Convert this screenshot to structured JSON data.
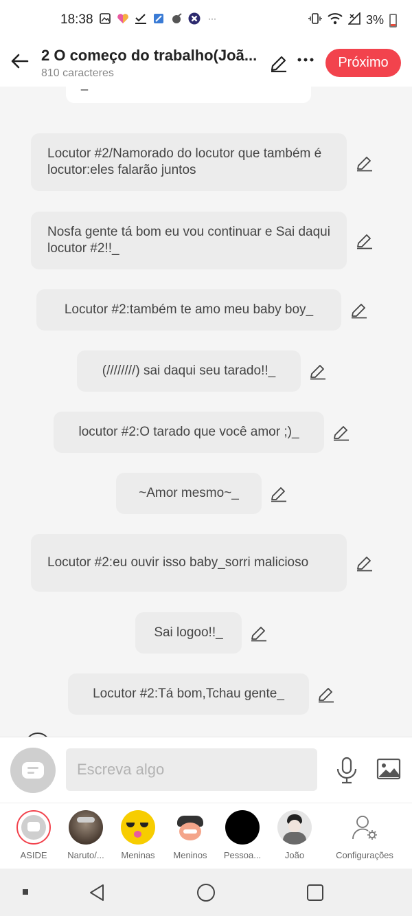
{
  "status_bar": {
    "time": "18:38",
    "battery": "3%",
    "icons_left": [
      "gallery-icon",
      "heart-app-icon",
      "check-icon",
      "app-icon",
      "app-icon-2",
      "x-app-icon",
      "more-notifications-icon"
    ],
    "icons_right": [
      "vibrate-icon",
      "wifi-icon",
      "no-signal-icon",
      "battery-icon"
    ]
  },
  "header": {
    "title": "2 O começo do trabalho(Joã...",
    "subtitle": "810 caracteres",
    "next_label": "Próximo",
    "accent": "#f2434d"
  },
  "messages": [
    {
      "text": "Locutor #2/Namorado do locutor que também é locutor:eles falarão juntos"
    },
    {
      "text": "Nosfa gente tá bom eu vou continuar e Sai daqui locutor #2!!_"
    },
    {
      "text": "Locutor #2:também te amo meu baby boy_"
    },
    {
      "text": "(////////) sai daqui seu tarado!!_"
    },
    {
      "text": "locutor #2:O tarado que você amor ;)_"
    },
    {
      "text": "~Amor mesmo~_"
    },
    {
      "text": "Locutor #2:eu ouvir isso baby_sorri malicioso"
    },
    {
      "text": "Sai logoo!!_"
    },
    {
      "text": "Locutor #2:Tá bom,Tchau gente_"
    }
  ],
  "partial_bubble_text": "_",
  "input": {
    "placeholder": "Escreva algo"
  },
  "characters": [
    {
      "label": "ASIDE"
    },
    {
      "label": "Naruto/..."
    },
    {
      "label": "Meninas"
    },
    {
      "label": "Meninos"
    },
    {
      "label": "Pessoa..."
    },
    {
      "label": "João"
    },
    {
      "label": "Configurações"
    }
  ]
}
